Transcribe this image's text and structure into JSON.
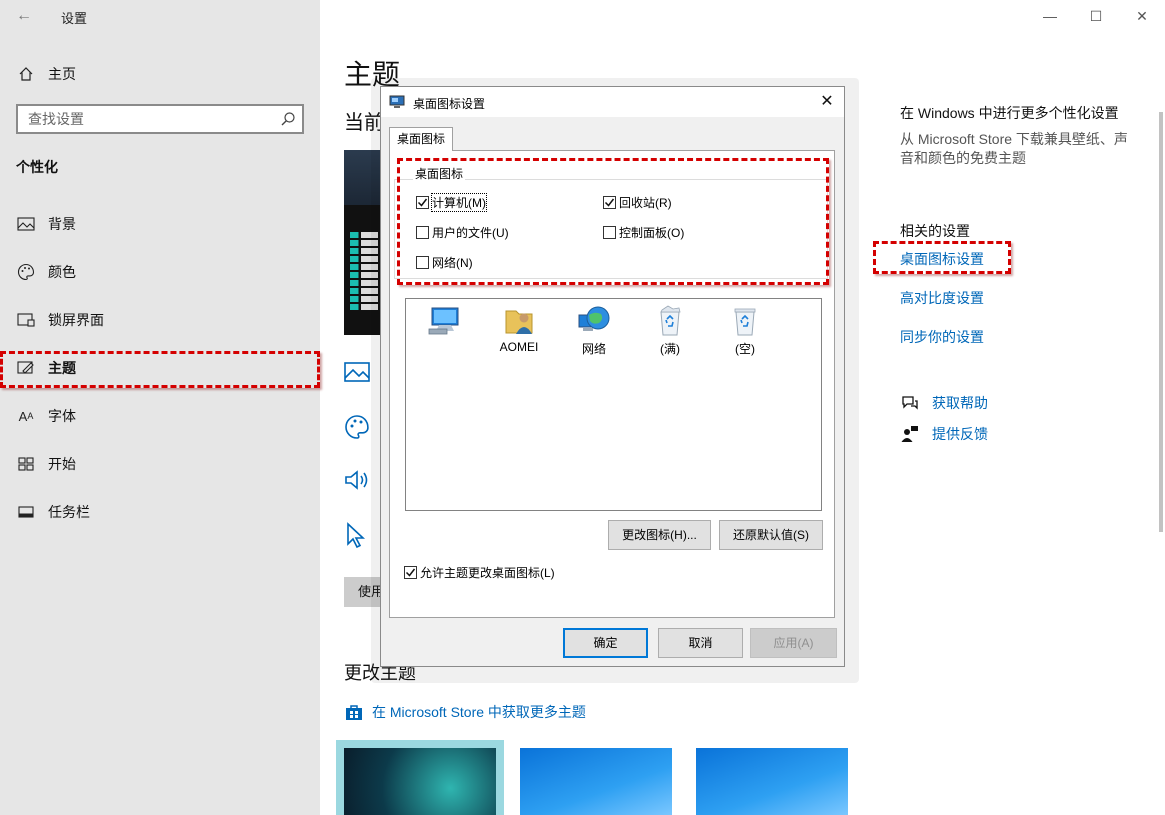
{
  "window": {
    "title": "设置",
    "controls": {
      "minimize": "—",
      "maximize": "☐",
      "close": "✕"
    }
  },
  "sidebar": {
    "home_label": "主页",
    "search_placeholder": "查找设置",
    "section_title": "个性化",
    "items": [
      {
        "label": "背景",
        "icon": "background-icon"
      },
      {
        "label": "颜色",
        "icon": "palette-icon"
      },
      {
        "label": "锁屏界面",
        "icon": "lock-screen-icon"
      },
      {
        "label": "主题",
        "icon": "theme-icon",
        "active": true
      },
      {
        "label": "字体",
        "icon": "font-icon"
      },
      {
        "label": "开始",
        "icon": "start-icon"
      },
      {
        "label": "任务栏",
        "icon": "taskbar-icon"
      }
    ]
  },
  "main": {
    "page_title": "主题",
    "current_label": "当前",
    "use_button": "使用",
    "change_theme": "更改主题",
    "store_link": "在 Microsoft Store 中获取更多主题"
  },
  "right": {
    "heading": "在 Windows 中进行更多个性化设置",
    "description": "从 Microsoft Store 下载兼具壁纸、声音和颜色的免费主题",
    "related_heading": "相关的设置",
    "links": [
      "桌面图标设置",
      "高对比度设置",
      "同步你的设置"
    ],
    "help": "获取帮助",
    "feedback": "提供反馈"
  },
  "dialog": {
    "title": "桌面图标设置",
    "tab": "桌面图标",
    "group_legend": "桌面图标",
    "checkboxes": {
      "computer": {
        "label": "计算机(M)",
        "checked": true
      },
      "recycle": {
        "label": "回收站(R)",
        "checked": true
      },
      "user_files": {
        "label": "用户的文件(U)",
        "checked": false
      },
      "control_panel": {
        "label": "控制面板(O)",
        "checked": false
      },
      "network": {
        "label": "网络(N)",
        "checked": false
      }
    },
    "icons": [
      {
        "label": "",
        "icon": "computer-icon"
      },
      {
        "label": "AOMEI",
        "icon": "user-folder-icon"
      },
      {
        "label": "网络",
        "icon": "network-globe-icon"
      },
      {
        "label": "(满)",
        "icon": "recycle-bin-full-icon"
      },
      {
        "label": "(空)",
        "icon": "recycle-bin-empty-icon"
      }
    ],
    "change_icon_button": "更改图标(H)...",
    "restore_default_button": "还原默认值(S)",
    "allow_themes_checkbox": {
      "label": "允许主题更改桌面图标(L)",
      "checked": true
    },
    "ok_button": "确定",
    "cancel_button": "取消",
    "apply_button": "应用(A)"
  },
  "colors": {
    "accent": "#0067b8",
    "highlight": "#d40000",
    "sidebar_bg": "#e6e6e6"
  }
}
